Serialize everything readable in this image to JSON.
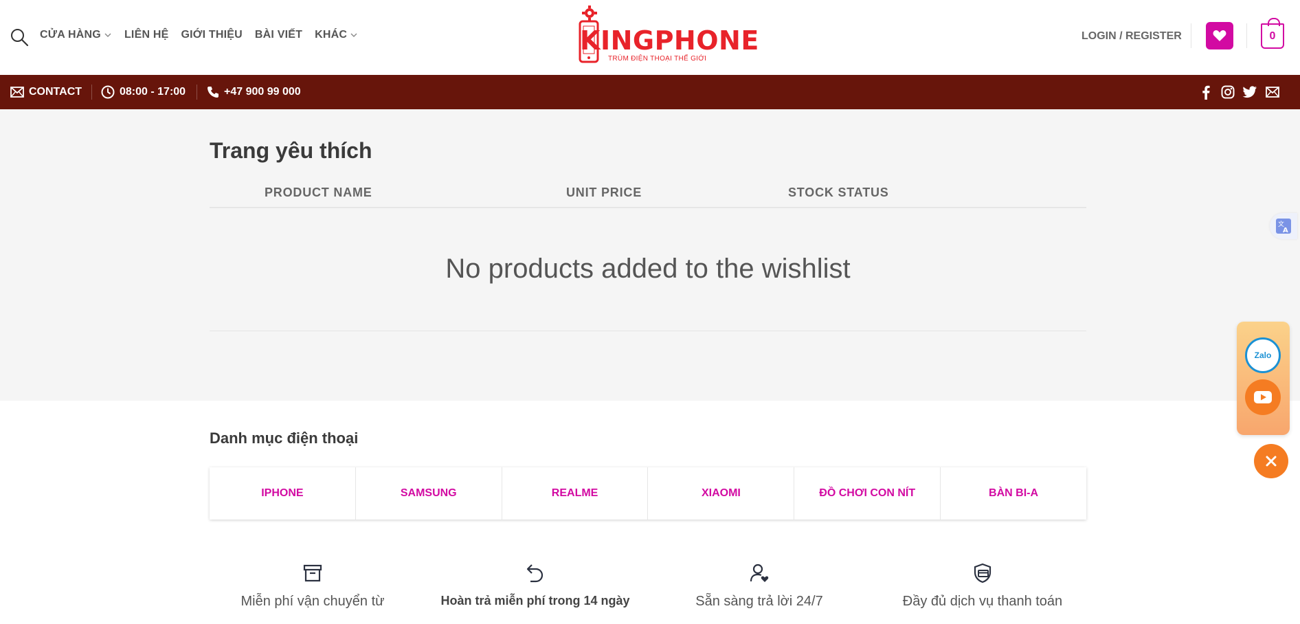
{
  "header": {
    "nav": [
      {
        "label": "CỬA HÀNG",
        "has_dropdown": true
      },
      {
        "label": "LIÊN HỆ",
        "has_dropdown": false
      },
      {
        "label": "GIỚI THIỆU",
        "has_dropdown": false
      },
      {
        "label": "BÀI VIẾT",
        "has_dropdown": false
      },
      {
        "label": "KHÁC",
        "has_dropdown": true
      }
    ],
    "logo": {
      "word": "KINGPHONE",
      "tagline": "TRÙM ĐIỆN THOẠI THẾ GIỚI"
    },
    "login_label": "LOGIN / REGISTER",
    "cart_count": "0",
    "icons": {
      "search": "search-icon",
      "wishlist": "heart-icon",
      "cart": "bag-icon"
    }
  },
  "topbar": {
    "contact_label": "CONTACT",
    "hours": "08:00 - 17:00",
    "phone": "+47 900 99 000",
    "social": [
      "facebook-icon",
      "instagram-icon",
      "twitter-icon",
      "mail-icon"
    ]
  },
  "wishlist": {
    "title": "Trang yêu thích",
    "columns": [
      "PRODUCT NAME",
      "UNIT PRICE",
      "STOCK STATUS"
    ],
    "empty_message": "No products added to the wishlist"
  },
  "categories": {
    "title": "Danh mục điện thoại",
    "items": [
      "IPHONE",
      "SAMSUNG",
      "REALME",
      "XIAOMI",
      "ĐỒ CHƠI CON NÍT",
      "BÀN BI-A"
    ]
  },
  "features": [
    {
      "icon": "archive-icon",
      "text": "Miễn phí vận chuyển từ"
    },
    {
      "icon": "undo-icon",
      "text": "Hoàn trả miễn phí trong 14 ngày"
    },
    {
      "icon": "user-heart-icon",
      "text": "Sẵn sàng trả lời 24/7"
    },
    {
      "icon": "payment-shield-icon",
      "text": "Đầy đủ dịch vụ thanh toán"
    }
  ],
  "floating": {
    "zalo_label": "Zalo"
  },
  "colors": {
    "accent": "#d20aa2",
    "topbar": "#67150b",
    "logo": "#e8232a",
    "float_orange": "#f57c22"
  }
}
